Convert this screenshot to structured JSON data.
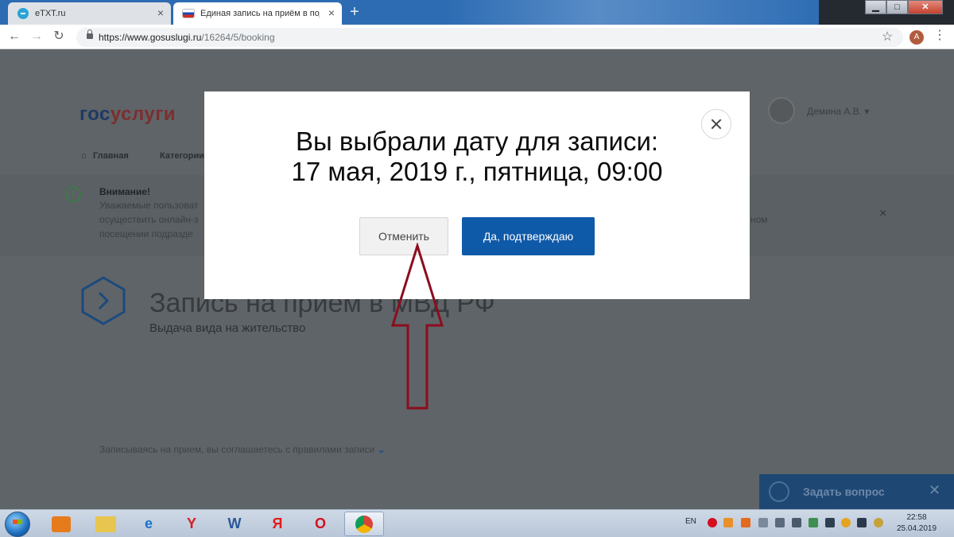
{
  "browser": {
    "tabs": [
      {
        "label": "eTXT.ru",
        "close": "×"
      },
      {
        "label": "Единая запись на приём в подр",
        "close": "×"
      }
    ],
    "new_tab": "+",
    "url_host": "https://www.gosuslugi.ru",
    "url_path": "/16264/5/booking",
    "profile_initial": "A",
    "window_buttons": [
      "▁",
      "□",
      "✕"
    ]
  },
  "page": {
    "logo_part1": "гос",
    "logo_part2": "услуги",
    "user_name": "Демина А.В. ▾",
    "nav": [
      "Главная",
      "Категории"
    ],
    "alert": {
      "title": "Внимание!",
      "line1": "Уважаемые пользоват",
      "line2": "осуществить онлайн-з",
      "line3": "посещении подразде",
      "right_fragment": "ном",
      "close": "×"
    },
    "service_title": "Запись на прием в МВД РФ",
    "service_subtitle": "Выдача вида на жительство",
    "agree_text": "Записываясь на прием, вы соглашаетесь с правилами записи",
    "chat_label": "Задать вопрос",
    "chat_close": "✕"
  },
  "modal": {
    "heading_line1": "Вы выбрали дату для записи:",
    "heading_line2": "17 мая, 2019 г., пятница, 09:00",
    "cancel_label": "Отменить",
    "confirm_label": "Да, подтверждаю"
  },
  "annotation": {
    "arrow_color": "#8b0d1e"
  },
  "taskbar": {
    "lang": "EN",
    "time": "22:58",
    "date": "25.04.2019"
  }
}
